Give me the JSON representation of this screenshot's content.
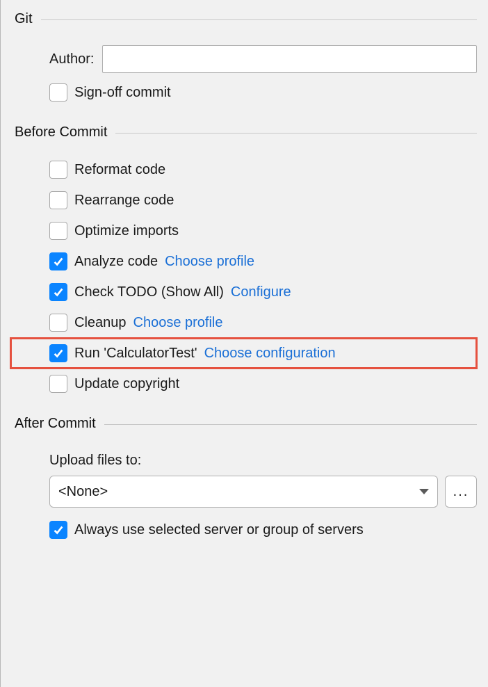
{
  "git": {
    "title": "Git",
    "author_label": "Author:",
    "author_value": "",
    "signoff": {
      "label": "Sign-off commit",
      "checked": false
    }
  },
  "before": {
    "title": "Before Commit",
    "items": [
      {
        "label": "Reformat code",
        "checked": false,
        "link": null
      },
      {
        "label": "Rearrange code",
        "checked": false,
        "link": null
      },
      {
        "label": "Optimize imports",
        "checked": false,
        "link": null
      },
      {
        "label": "Analyze code",
        "checked": true,
        "link": "Choose profile"
      },
      {
        "label": "Check TODO (Show All)",
        "checked": true,
        "link": "Configure"
      },
      {
        "label": "Cleanup",
        "checked": false,
        "link": "Choose profile"
      },
      {
        "label": "Run 'CalculatorTest'",
        "checked": true,
        "link": "Choose configuration",
        "highlight": true
      },
      {
        "label": "Update copyright",
        "checked": false,
        "link": null
      }
    ]
  },
  "after": {
    "title": "After Commit",
    "upload_label": "Upload files to:",
    "upload_value": "<None>",
    "browse_label": "...",
    "always_use": {
      "label": "Always use selected server or group of servers",
      "checked": true
    }
  }
}
